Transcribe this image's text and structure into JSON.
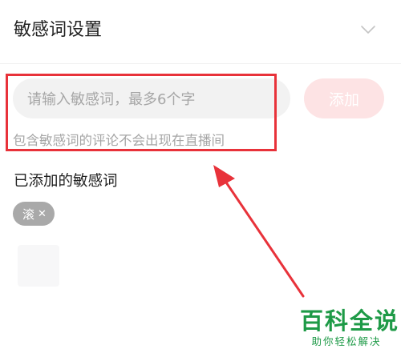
{
  "header": {
    "title": "敏感词设置",
    "collapse_icon": "chevron-down-icon"
  },
  "input": {
    "placeholder": "请输入敏感词，最多6个字",
    "value": ""
  },
  "add_button": {
    "label": "添加"
  },
  "hint": "包含敏感词的评论不会出现在直播间",
  "added_section": {
    "title": "已添加的敏感词",
    "words": [
      {
        "label": "滚",
        "remove_icon": "close-icon"
      }
    ]
  },
  "watermark": {
    "title": "百科全说",
    "subtitle": "助你轻松解决"
  },
  "colors": {
    "accent_disabled": "#fde3e4",
    "annotation": "#e8323a",
    "watermark": "#1e9a47",
    "chip": "#a9a9a9"
  }
}
